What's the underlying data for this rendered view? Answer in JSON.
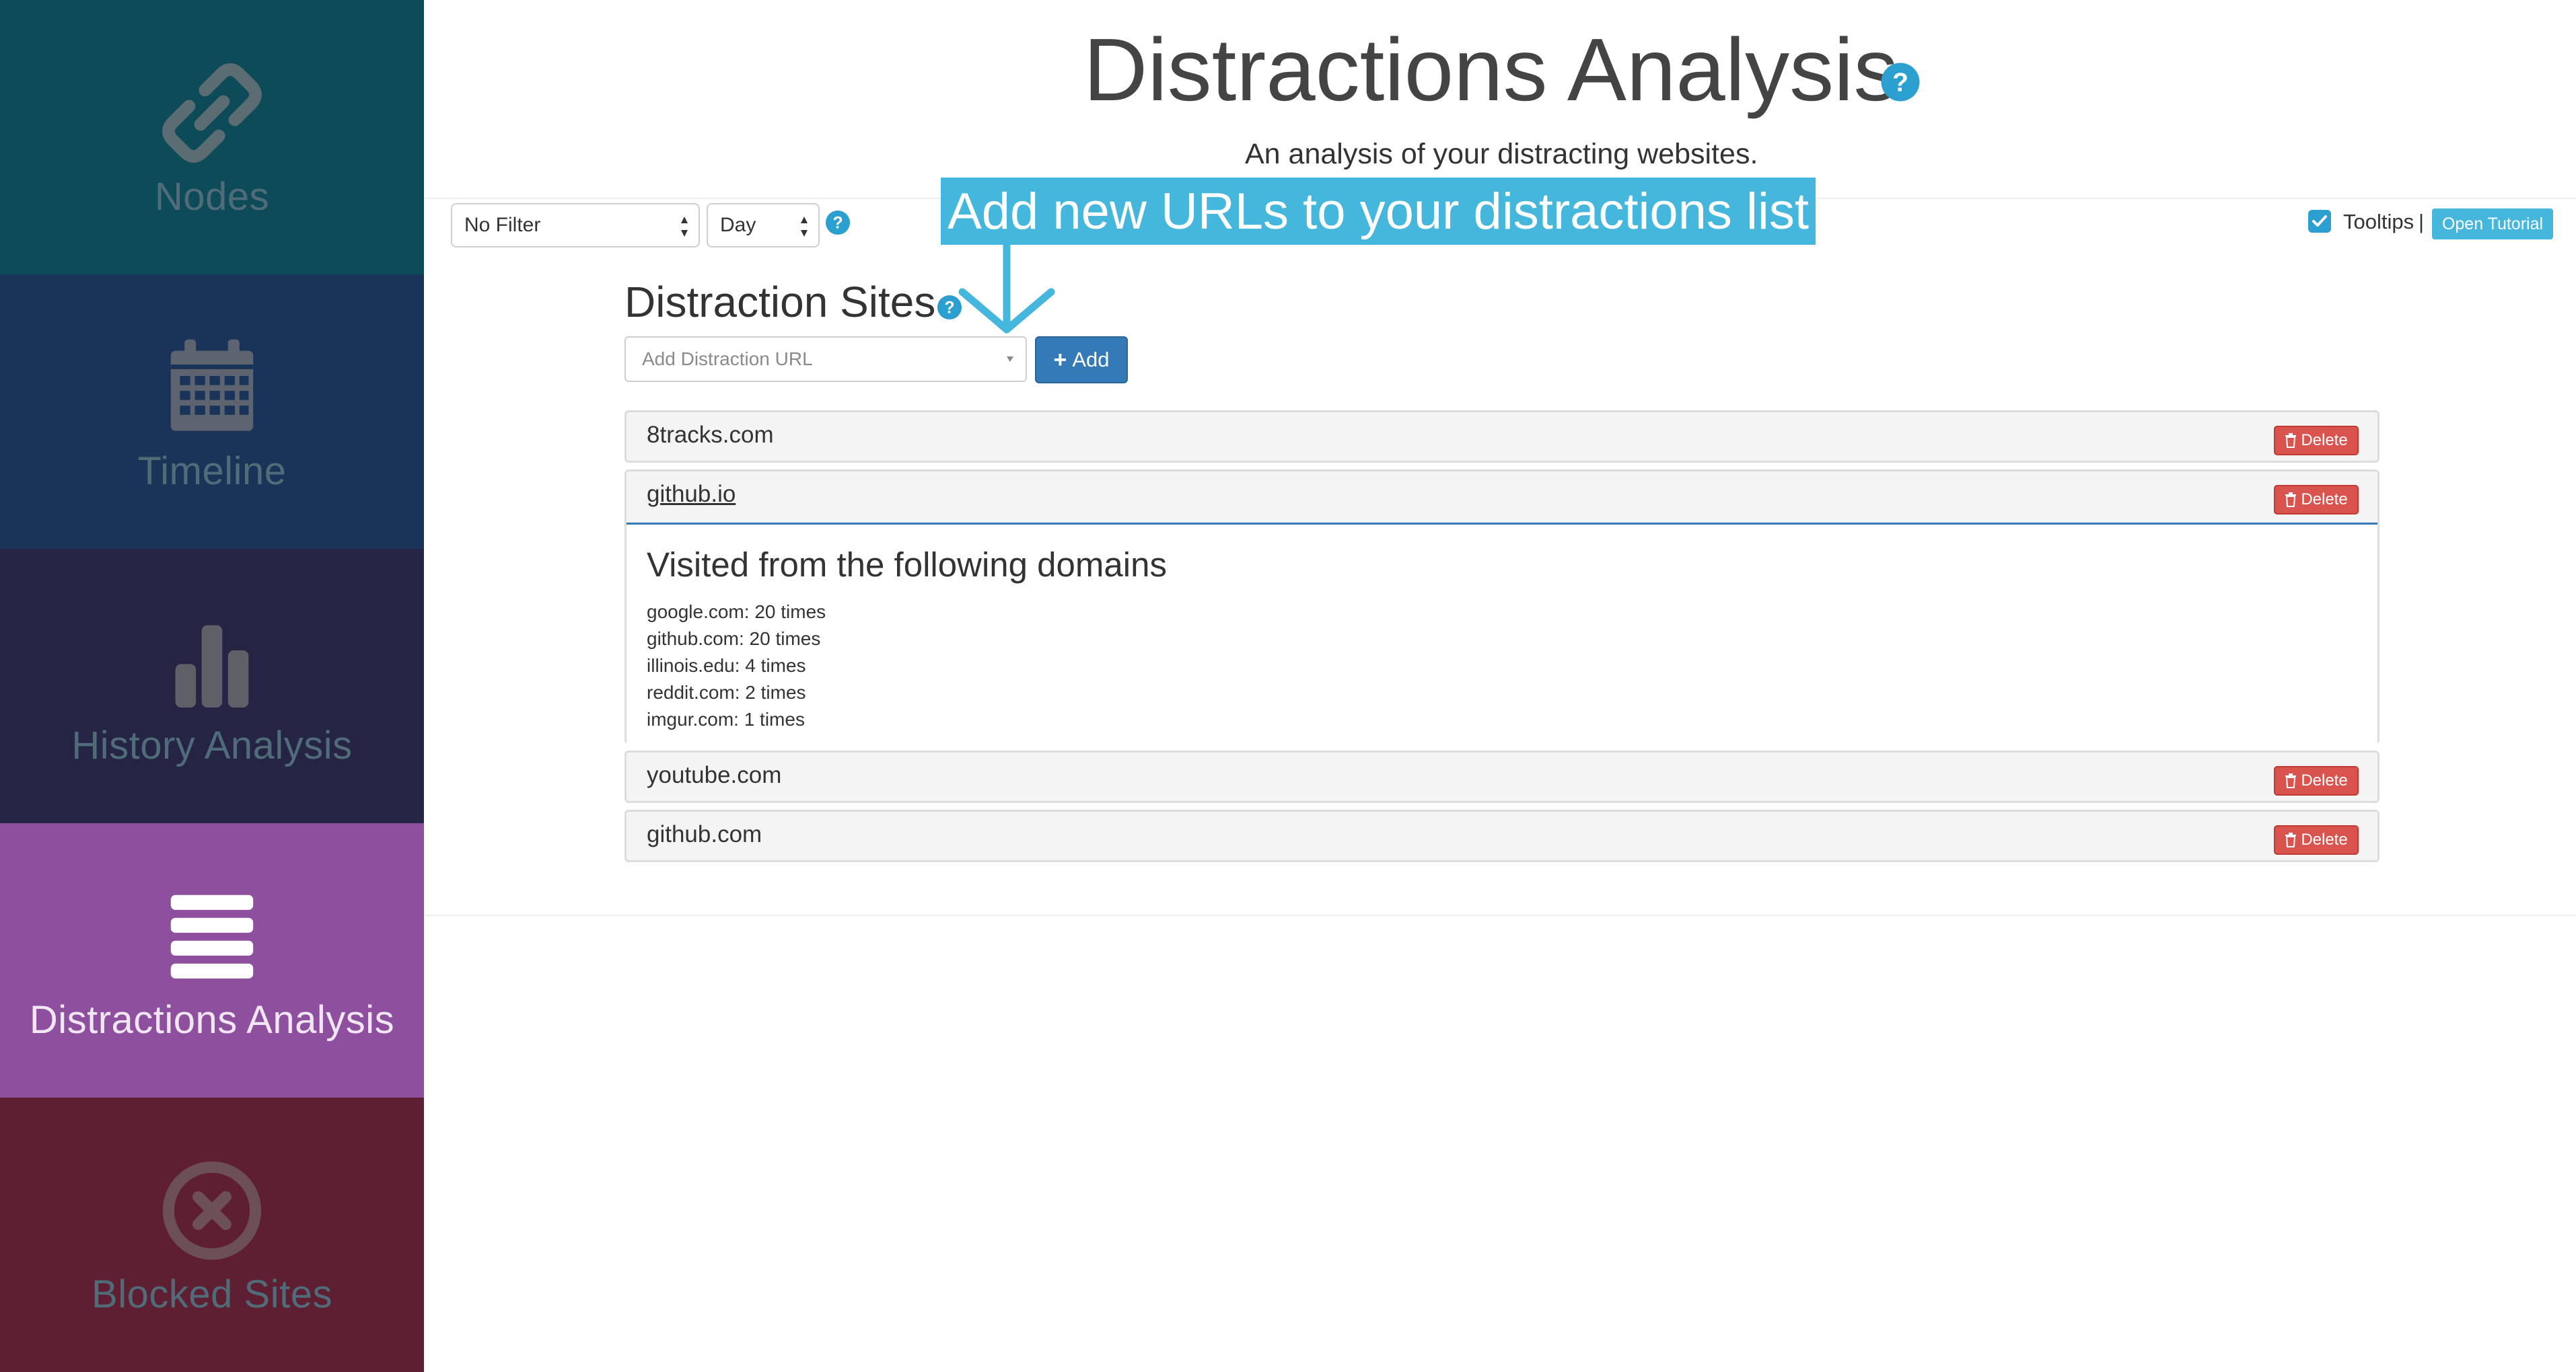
{
  "sidebar": {
    "items": [
      {
        "label": "Nodes",
        "icon": "link-icon"
      },
      {
        "label": "Timeline",
        "icon": "calendar-icon"
      },
      {
        "label": "History Analysis",
        "icon": "bar-chart-icon"
      },
      {
        "label": "Distractions Analysis",
        "icon": "list-icon",
        "active": true
      },
      {
        "label": "Blocked Sites",
        "icon": "blocked-circle-icon"
      }
    ]
  },
  "header": {
    "title": "Distractions Analysis",
    "subtitle": "An analysis of your distracting websites."
  },
  "filters": {
    "filter_value": "No Filter",
    "period_value": "Day"
  },
  "toolbar": {
    "tooltips_label": "Tooltips",
    "tooltips_checked": true,
    "separator": "|",
    "open_tutorial_label": "Open Tutorial"
  },
  "callout": {
    "text": "Add new URLs to your distractions list"
  },
  "section": {
    "heading": "Distraction Sites",
    "add_url_placeholder": "Add Distraction URL",
    "add_button_label": "Add"
  },
  "sites": [
    {
      "url": "8tracks.com",
      "delete_label": "Delete"
    },
    {
      "url": "github.io",
      "delete_label": "Delete",
      "expanded": true
    },
    {
      "url": "youtube.com",
      "delete_label": "Delete"
    },
    {
      "url": "github.com",
      "delete_label": "Delete"
    }
  ],
  "expanded_detail": {
    "heading": "Visited from the following domains",
    "domains": [
      "google.com: 20 times",
      "github.com: 20 times",
      "illinois.edu: 4 times",
      "reddit.com: 2 times",
      "imgur.com: 1 times"
    ]
  },
  "colors": {
    "accent_blue": "#45b7dc",
    "primary_button": "#337ab7",
    "danger_button": "#d9534f",
    "sidebar_active": "#8e509e"
  }
}
